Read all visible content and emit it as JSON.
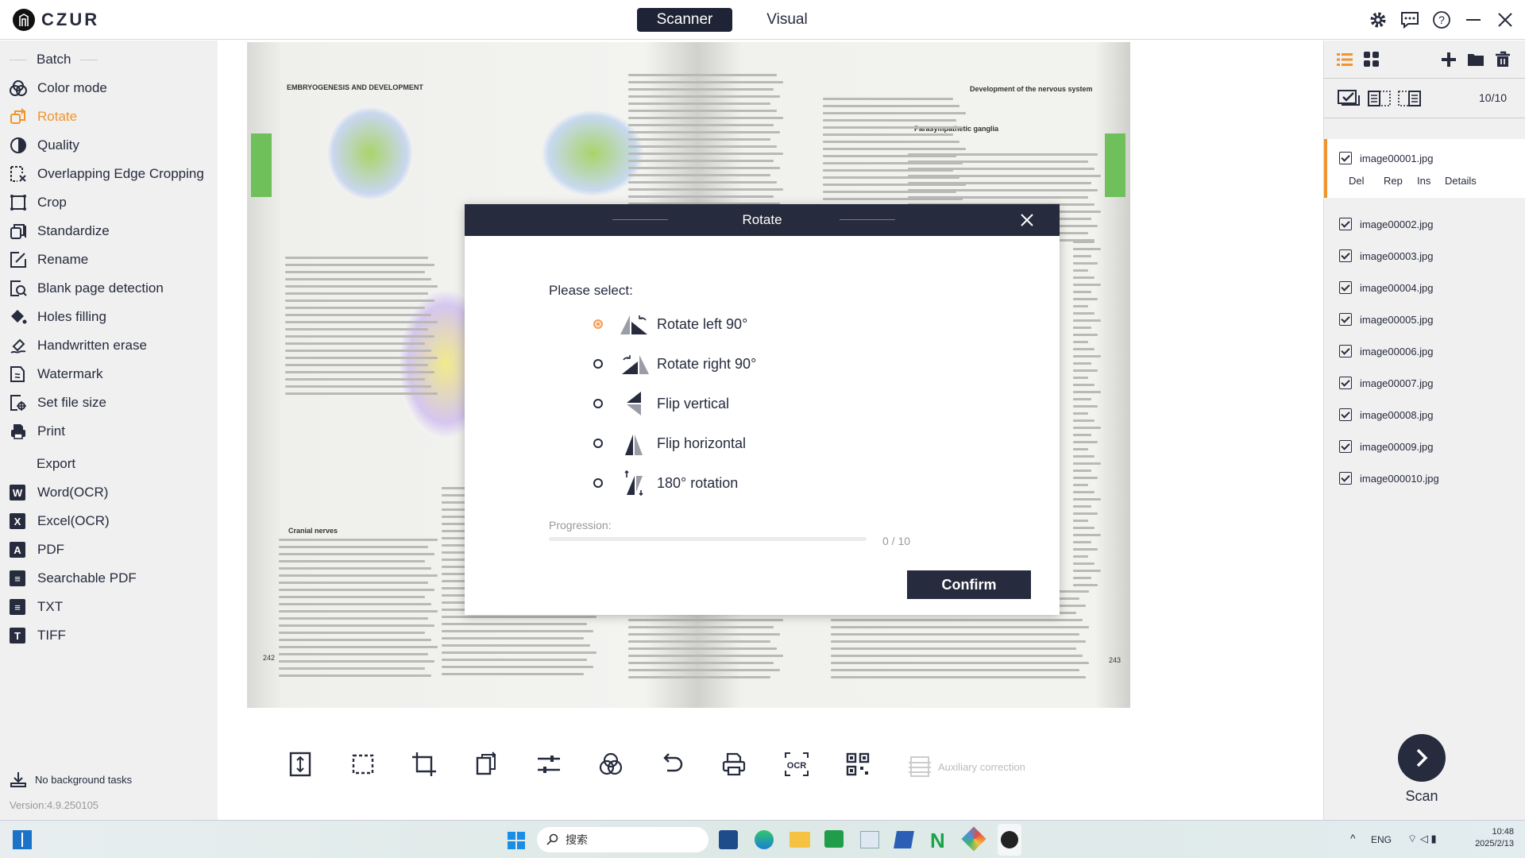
{
  "app": {
    "brand": "CZUR",
    "tabs": [
      {
        "label": "Scanner",
        "active": true
      },
      {
        "label": "Visual",
        "active": false
      }
    ],
    "window_icons": [
      "gear-icon",
      "chat-icon",
      "help-icon",
      "minimize-icon",
      "close-icon"
    ]
  },
  "colors": {
    "accent": "#f0952d",
    "dark": "#262b3d"
  },
  "sidebar": {
    "batch_label": "Batch",
    "batch_items": [
      {
        "label": "Color mode",
        "icon": "color-mode-icon"
      },
      {
        "label": "Rotate",
        "icon": "rotate-icon",
        "active": true
      },
      {
        "label": "Quality",
        "icon": "quality-icon"
      },
      {
        "label": "Overlapping Edge Cropping",
        "icon": "edge-crop-icon"
      },
      {
        "label": "Crop",
        "icon": "crop-icon"
      },
      {
        "label": "Standardize",
        "icon": "standardize-icon"
      },
      {
        "label": "Rename",
        "icon": "rename-icon"
      },
      {
        "label": "Blank page detection",
        "icon": "blank-page-icon"
      },
      {
        "label": "Holes filling",
        "icon": "paint-bucket-icon"
      },
      {
        "label": "Handwritten erase",
        "icon": "eraser-icon"
      },
      {
        "label": "Watermark",
        "icon": "watermark-icon"
      },
      {
        "label": "Set file size",
        "icon": "file-size-icon"
      },
      {
        "label": "Print",
        "icon": "print-icon"
      }
    ],
    "export_label": "Export",
    "export_items": [
      {
        "label": "Word(OCR)",
        "icon": "word-icon",
        "glyph": "W"
      },
      {
        "label": "Excel(OCR)",
        "icon": "excel-icon",
        "glyph": "X"
      },
      {
        "label": "PDF",
        "icon": "pdf-icon",
        "glyph": "A"
      },
      {
        "label": "Searchable PDF",
        "icon": "searchable-pdf-icon",
        "glyph": "≡"
      },
      {
        "label": "TXT",
        "icon": "txt-icon",
        "glyph": "≡"
      },
      {
        "label": "TIFF",
        "icon": "tiff-icon",
        "glyph": "T"
      }
    ],
    "background_tasks": "No background tasks",
    "version": "Version:4.9.250105"
  },
  "document": {
    "left_header": "EMBRYOGENESIS AND DEVELOPMENT",
    "right_header": "Development of the nervous system",
    "left_section": "Cranial nerves",
    "right_section": "Parasympathetic ganglia",
    "left_page": "242",
    "right_page": "243"
  },
  "toolbar": {
    "tools": [
      "fit-height-icon",
      "select-area-icon",
      "crop-icon",
      "rotate-page-icon",
      "adjust-icon",
      "color-mode-icon",
      "undo-icon",
      "print-icon",
      "ocr-icon",
      "qr-code-icon"
    ],
    "ocr_label": "OCR",
    "auxiliary_label": "Auxiliary correction"
  },
  "right_panel": {
    "count": "10/10",
    "item_actions": [
      "Del",
      "Rep",
      "Ins",
      "Details"
    ],
    "files": [
      {
        "name": "image00001.jpg",
        "checked": true,
        "selected": true
      },
      {
        "name": "image00002.jpg",
        "checked": true
      },
      {
        "name": "image00003.jpg",
        "checked": true
      },
      {
        "name": "image00004.jpg",
        "checked": true
      },
      {
        "name": "image00005.jpg",
        "checked": true
      },
      {
        "name": "image00006.jpg",
        "checked": true
      },
      {
        "name": "image00007.jpg",
        "checked": true
      },
      {
        "name": "image00008.jpg",
        "checked": true
      },
      {
        "name": "image00009.jpg",
        "checked": true
      },
      {
        "name": "image000010.jpg",
        "checked": true
      }
    ],
    "scan_label": "Scan"
  },
  "dialog": {
    "title": "Rotate",
    "prompt": "Please select:",
    "options": [
      {
        "label": "Rotate left 90°",
        "selected": true
      },
      {
        "label": "Rotate right 90°",
        "selected": false
      },
      {
        "label": "Flip vertical",
        "selected": false
      },
      {
        "label": "Flip horizontal",
        "selected": false
      },
      {
        "label": "180° rotation",
        "selected": false
      }
    ],
    "progress_label": "Progression:",
    "progress_text": "0 / 10",
    "progress_fraction": 0,
    "confirm_label": "Confirm"
  },
  "taskbar": {
    "search_placeholder": "搜索",
    "lang": "ENG",
    "time": "10:48",
    "date": "2025/2/13"
  }
}
